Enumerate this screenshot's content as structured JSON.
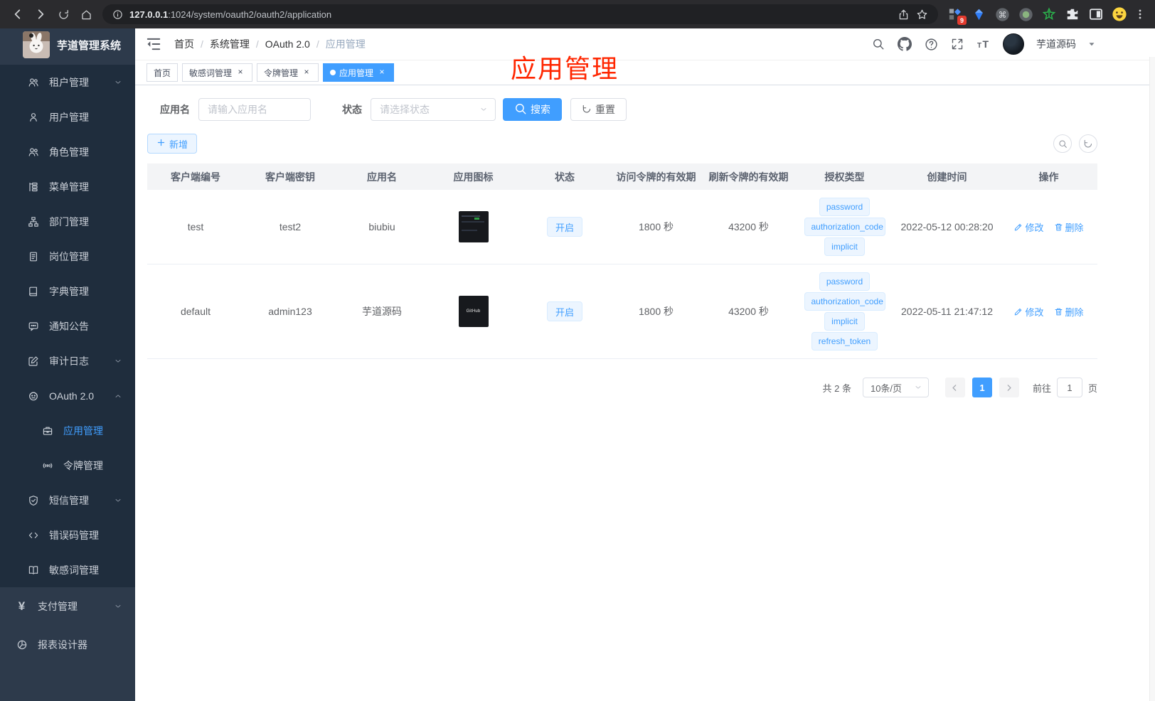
{
  "browser": {
    "url_host": "127.0.0.1",
    "url_path": ":1024/system/oauth2/oauth2/application",
    "extension_badge": "9",
    "icons": [
      "back-icon",
      "forward-icon",
      "reload-icon",
      "home-icon",
      "info-icon",
      "share-icon",
      "star-icon"
    ],
    "extensions": [
      "ext-tasks-icon",
      "ext-gem-icon",
      "ext-cmd-icon",
      "ext-record-icon",
      "ext-green-star-icon",
      "ext-puzzle-icon",
      "ext-split-view-icon",
      "ext-emoji-icon"
    ]
  },
  "app": {
    "logo_title": "芋道管理系统",
    "annotation": "应用管理"
  },
  "sidebar": {
    "menu": [
      {
        "id": "tenant",
        "label": "租户管理",
        "icon": "users-icon",
        "level": "sub",
        "arrow": "down"
      },
      {
        "id": "user",
        "label": "用户管理",
        "icon": "user-icon",
        "level": "sub"
      },
      {
        "id": "role",
        "label": "角色管理",
        "icon": "role-icon",
        "level": "sub"
      },
      {
        "id": "menu",
        "label": "菜单管理",
        "icon": "menu-icon",
        "level": "sub"
      },
      {
        "id": "dept",
        "label": "部门管理",
        "icon": "dept-icon",
        "level": "sub"
      },
      {
        "id": "post",
        "label": "岗位管理",
        "icon": "post-icon",
        "level": "sub"
      },
      {
        "id": "dict",
        "label": "字典管理",
        "icon": "dict-icon",
        "level": "sub"
      },
      {
        "id": "notice",
        "label": "通知公告",
        "icon": "notice-icon",
        "level": "sub"
      },
      {
        "id": "audit",
        "label": "审计日志",
        "icon": "audit-icon",
        "level": "sub",
        "arrow": "down"
      },
      {
        "id": "oauth",
        "label": "OAuth 2.0",
        "icon": "oauth-icon",
        "level": "sub",
        "arrow": "up"
      },
      {
        "id": "oauth-app",
        "label": "应用管理",
        "icon": "briefcase-icon",
        "level": "sub2",
        "active": true
      },
      {
        "id": "oauth-token",
        "label": "令牌管理",
        "icon": "token-icon",
        "level": "sub2"
      },
      {
        "id": "sms",
        "label": "短信管理",
        "icon": "shield-icon",
        "level": "sub",
        "arrow": "down"
      },
      {
        "id": "errcode",
        "label": "错误码管理",
        "icon": "code-icon",
        "level": "sub"
      },
      {
        "id": "sensitive",
        "label": "敏感词管理",
        "icon": "book-icon",
        "level": "sub"
      },
      {
        "id": "pay",
        "label": "支付管理",
        "icon": "yen-icon",
        "level": "top",
        "arrow": "down"
      },
      {
        "id": "report",
        "label": "报表设计器",
        "icon": "report-icon",
        "level": "top"
      }
    ]
  },
  "navbar": {
    "breadcrumb": [
      "首页",
      "系统管理",
      "OAuth 2.0",
      "应用管理"
    ],
    "icons": [
      "search-icon",
      "github-icon",
      "help-icon",
      "fullscreen-icon",
      "font-size-icon"
    ],
    "username": "芋道源码"
  },
  "tabs": [
    {
      "id": "home",
      "label": "首页",
      "closable": false,
      "active": false
    },
    {
      "id": "sensitive-word",
      "label": "敏感词管理",
      "closable": true,
      "active": false
    },
    {
      "id": "token",
      "label": "令牌管理",
      "closable": true,
      "active": false
    },
    {
      "id": "application",
      "label": "应用管理",
      "closable": true,
      "active": true
    }
  ],
  "filters": {
    "name_label": "应用名",
    "name_placeholder": "请输入应用名",
    "status_label": "状态",
    "status_placeholder": "请选择状态",
    "search_label": "搜索",
    "reset_label": "重置",
    "add_label": "新增"
  },
  "table": {
    "columns": [
      "客户端编号",
      "客户端密钥",
      "应用名",
      "应用图标",
      "状态",
      "访问令牌的有效期",
      "刷新令牌的有效期",
      "授权类型",
      "创建时间",
      "操作"
    ],
    "rows": [
      {
        "client_id": "test",
        "client_secret": "test2",
        "name": "biubiu",
        "icon_kind": "screenshot",
        "status": "开启",
        "access_token_validity": "1800 秒",
        "refresh_token_validity": "43200 秒",
        "grant_types": [
          "password",
          "authorization_code",
          "implicit"
        ],
        "create_time": "2022-05-12 00:28:20",
        "edit_label": "修改",
        "delete_label": "删除"
      },
      {
        "client_id": "default",
        "client_secret": "admin123",
        "name": "芋道源码",
        "icon_kind": "github",
        "icon_text": "GitHub",
        "status": "开启",
        "access_token_validity": "1800 秒",
        "refresh_token_validity": "43200 秒",
        "grant_types": [
          "password",
          "authorization_code",
          "implicit",
          "refresh_token"
        ],
        "create_time": "2022-05-11 21:47:12",
        "edit_label": "修改",
        "delete_label": "删除"
      }
    ]
  },
  "pagination": {
    "total": "共 2 条",
    "page_size": "10条/页",
    "current_page": "1",
    "goto_label": "前往",
    "goto_value": "1",
    "page_suffix": "页"
  },
  "colors": {
    "accent": "#409eff",
    "annotation_red": "#ff2600",
    "tag_bg": "#ecf5ff",
    "sidebar_bg": "#2d3a4b",
    "sidebar_submenu_bg": "#1f2d3d",
    "active_tab_bg": "#409eff"
  }
}
